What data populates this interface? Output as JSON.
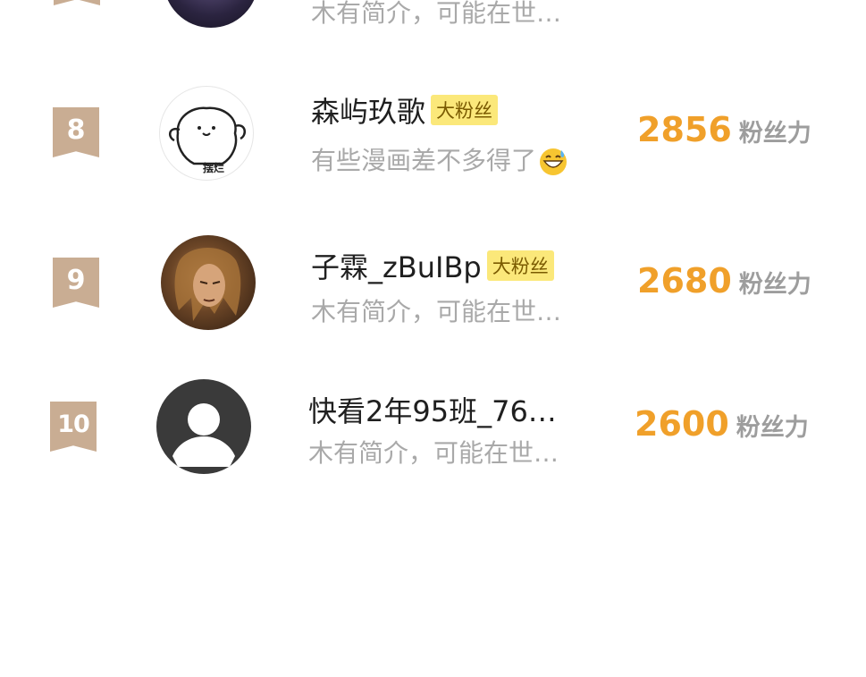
{
  "top_partial": {
    "bio": "木有简介，可能在世…"
  },
  "rows": [
    {
      "rank": "8",
      "name": "森屿玖歌",
      "tag": "大粉丝",
      "bio": "有些漫画差不多得了",
      "avatar_text": "摆烂",
      "score": "2856",
      "unit": "粉丝力"
    },
    {
      "rank": "9",
      "name": "子霖_zBuIBp",
      "tag": "大粉丝",
      "bio": "木有简介，可能在世…",
      "score": "2680",
      "unit": "粉丝力"
    },
    {
      "rank": "10",
      "name": "快看2年95班_76…",
      "bio": "木有简介，可能在世…",
      "score": "2600",
      "unit": "粉丝力"
    }
  ],
  "colors": {
    "rank_badge": "#c9ad93",
    "score": "#f0a02a",
    "tag_bg": "#fbe87a"
  }
}
